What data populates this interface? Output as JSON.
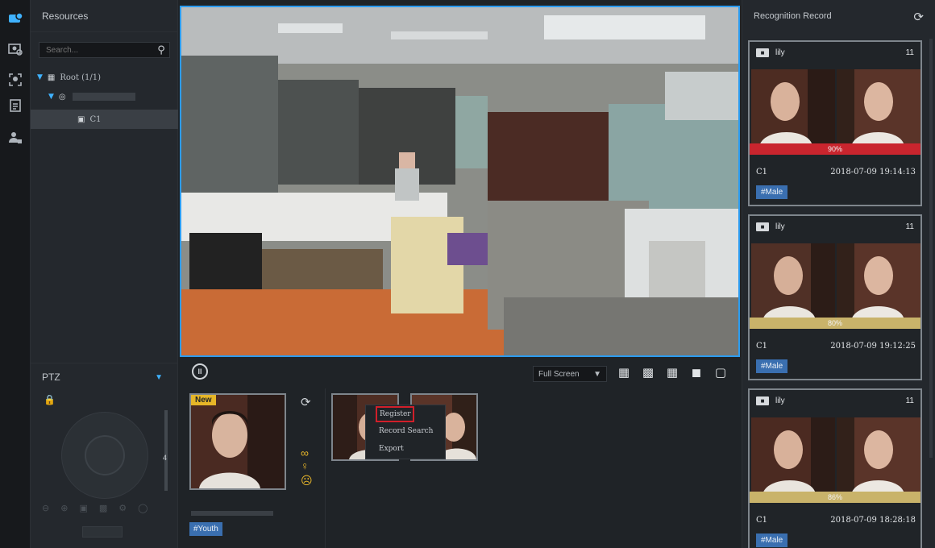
{
  "sidebar": {
    "items": [
      {
        "icon": "live-view-icon",
        "active": true
      },
      {
        "icon": "face-library-icon"
      },
      {
        "icon": "face-search-icon"
      },
      {
        "icon": "report-icon"
      },
      {
        "icon": "person-config-icon"
      }
    ]
  },
  "resources": {
    "title": "Resources",
    "search_placeholder": "Search...",
    "tree": {
      "root_label": "Root (1/1)",
      "channel_label": "C1"
    }
  },
  "ptz": {
    "title": "PTZ",
    "zoom_value": "4"
  },
  "toolbar": {
    "view_mode": "Full Screen"
  },
  "capture": {
    "new_tag": "New",
    "attribute_tag": "#Youth",
    "context_menu": [
      "Register",
      "Record Search",
      "Export"
    ]
  },
  "recognition": {
    "title": "Recognition Record",
    "records": [
      {
        "name": "lily",
        "count": "11",
        "score": "90%",
        "score_color": "#c9252e",
        "channel": "C1",
        "time": "2018-07-09 19:14:13",
        "tag": "#Male"
      },
      {
        "name": "lily",
        "count": "11",
        "score": "80%",
        "score_color": "#c9b36a",
        "channel": "C1",
        "time": "2018-07-09 19:12:25",
        "tag": "#Male"
      },
      {
        "name": "lily",
        "count": "11",
        "score": "86%",
        "score_color": "#c9b36a",
        "channel": "C1",
        "time": "2018-07-09 18:28:18",
        "tag": "#Male"
      }
    ]
  },
  "colors": {
    "accent": "#2c9cf0",
    "highlight_red": "#d11f2a",
    "tag_blue": "#3a6fb0",
    "new_yellow": "#e6b628"
  }
}
